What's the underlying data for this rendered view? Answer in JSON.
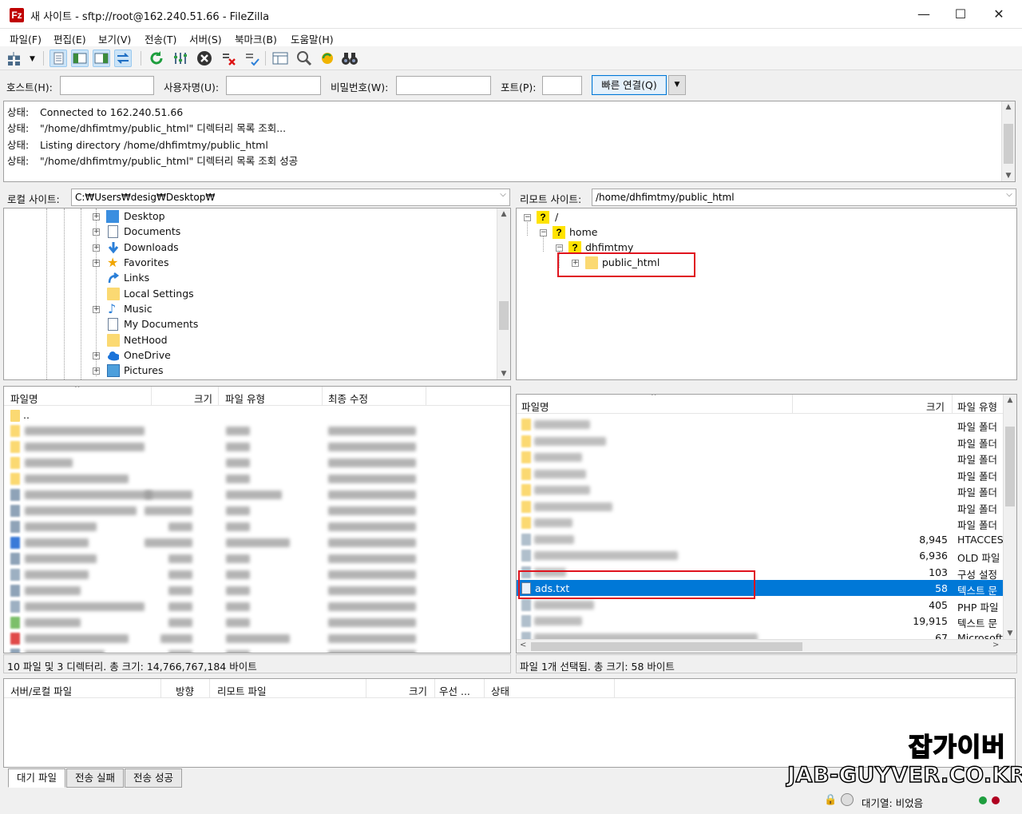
{
  "window": {
    "title": "새 사이트 - sftp://root@162.240.51.66 - FileZilla",
    "app_icon_letter": "Fz",
    "minimize": "—",
    "maximize": "☐",
    "close": "✕"
  },
  "menu": [
    "파일(F)",
    "편집(E)",
    "보기(V)",
    "전송(T)",
    "서버(S)",
    "북마크(B)",
    "도움말(H)"
  ],
  "quickconnect": {
    "host_label": "호스트(H):",
    "host_value": "",
    "user_label": "사용자명(U):",
    "user_value": "",
    "pass_label": "비밀번호(W):",
    "pass_value": "",
    "port_label": "포트(P):",
    "port_value": "",
    "connect_button": "빠른 연결(Q)",
    "dropdown": "▼"
  },
  "log": [
    {
      "label": "상태:",
      "text": "Connected to 162.240.51.66"
    },
    {
      "label": "상태:",
      "text": "\"/home/dhfimtmy/public_html\" 디렉터리 목록 조회..."
    },
    {
      "label": "상태:",
      "text": "Listing directory /home/dhfimtmy/public_html"
    },
    {
      "label": "상태:",
      "text": "\"/home/dhfimtmy/public_html\" 디렉터리 목록 조회 성공"
    }
  ],
  "local": {
    "site_label": "로컬 사이트:",
    "path": "C:₩Users₩desig₩Desktop₩",
    "tree": [
      {
        "name": "Desktop",
        "icon": "desktop-folder-icon",
        "expandable": true
      },
      {
        "name": "Documents",
        "icon": "documents-icon",
        "expandable": true
      },
      {
        "name": "Downloads",
        "icon": "download-arrow-icon",
        "expandable": true
      },
      {
        "name": "Favorites",
        "icon": "star-icon",
        "expandable": true
      },
      {
        "name": "Links",
        "icon": "shortcut-arrow-icon",
        "expandable": false
      },
      {
        "name": "Local Settings",
        "icon": "folder-icon",
        "expandable": false
      },
      {
        "name": "Music",
        "icon": "music-note-icon",
        "expandable": true
      },
      {
        "name": "My Documents",
        "icon": "documents-icon",
        "expandable": false
      },
      {
        "name": "NetHood",
        "icon": "folder-icon",
        "expandable": false
      },
      {
        "name": "OneDrive",
        "icon": "cloud-icon",
        "expandable": true
      },
      {
        "name": "Pictures",
        "icon": "pictures-icon",
        "expandable": true
      }
    ],
    "columns": {
      "name": "파일명",
      "size": "크기",
      "type": "파일 유형",
      "modified": "최종 수정"
    },
    "parent_dir": "..",
    "status": "10 파일 및 3 디렉터리. 총 크기: 14,766,767,184 바이트"
  },
  "remote": {
    "site_label": "리모트 사이트:",
    "path": "/home/dhfimtmy/public_html",
    "tree": [
      {
        "name": "/",
        "level": 0,
        "expander": "⊟"
      },
      {
        "name": "home",
        "level": 1,
        "expander": "⊟"
      },
      {
        "name": "dhfimtmy",
        "level": 2,
        "expander": "⊟"
      },
      {
        "name": "public_html",
        "level": 3,
        "expander": "⊞"
      }
    ],
    "columns": {
      "name": "파일명",
      "size": "크기",
      "type": "파일 유형"
    },
    "files": [
      {
        "name": "",
        "size": "",
        "type": "파일 폴더"
      },
      {
        "name": "",
        "size": "",
        "type": "파일 폴더"
      },
      {
        "name": "",
        "size": "",
        "type": "파일 폴더"
      },
      {
        "name": "",
        "size": "",
        "type": "파일 폴더"
      },
      {
        "name": "",
        "size": "",
        "type": "파일 폴더"
      },
      {
        "name": "",
        "size": "",
        "type": "파일 폴더"
      },
      {
        "name": "",
        "size": "",
        "type": "파일 폴더"
      },
      {
        "name": "",
        "size": "8,945",
        "type": "HTACCES"
      },
      {
        "name": "",
        "size": "6,936",
        "type": "OLD 파일"
      },
      {
        "name": "",
        "size": "103",
        "type": "구성 설정"
      },
      {
        "name": "ads.txt",
        "size": "58",
        "type": "텍스트 문",
        "selected": true
      },
      {
        "name": "",
        "size": "405",
        "type": "PHP 파일"
      },
      {
        "name": "",
        "size": "19,915",
        "type": "텍스트 문"
      },
      {
        "name": "",
        "size": "67",
        "type": "Microsoft"
      }
    ],
    "status": "파일 1개 선택됨. 총 크기: 58 바이트"
  },
  "queue": {
    "columns": {
      "server_file": "서버/로컬 파일",
      "direction": "방향",
      "remote_file": "리모트 파일",
      "size": "크기",
      "priority": "우선 ...",
      "status": "상태"
    },
    "tabs": [
      "대기 파일",
      "전송 실패",
      "전송 성공"
    ]
  },
  "app_status": {
    "queue": "대기열: 비었음"
  },
  "watermark": {
    "line1": "잡가이버",
    "line2": "JAB-GUYVER.CO.KR"
  },
  "colors": {
    "selection": "#0078d7",
    "highlight": "#e0141e",
    "folder": "#fbd972"
  }
}
